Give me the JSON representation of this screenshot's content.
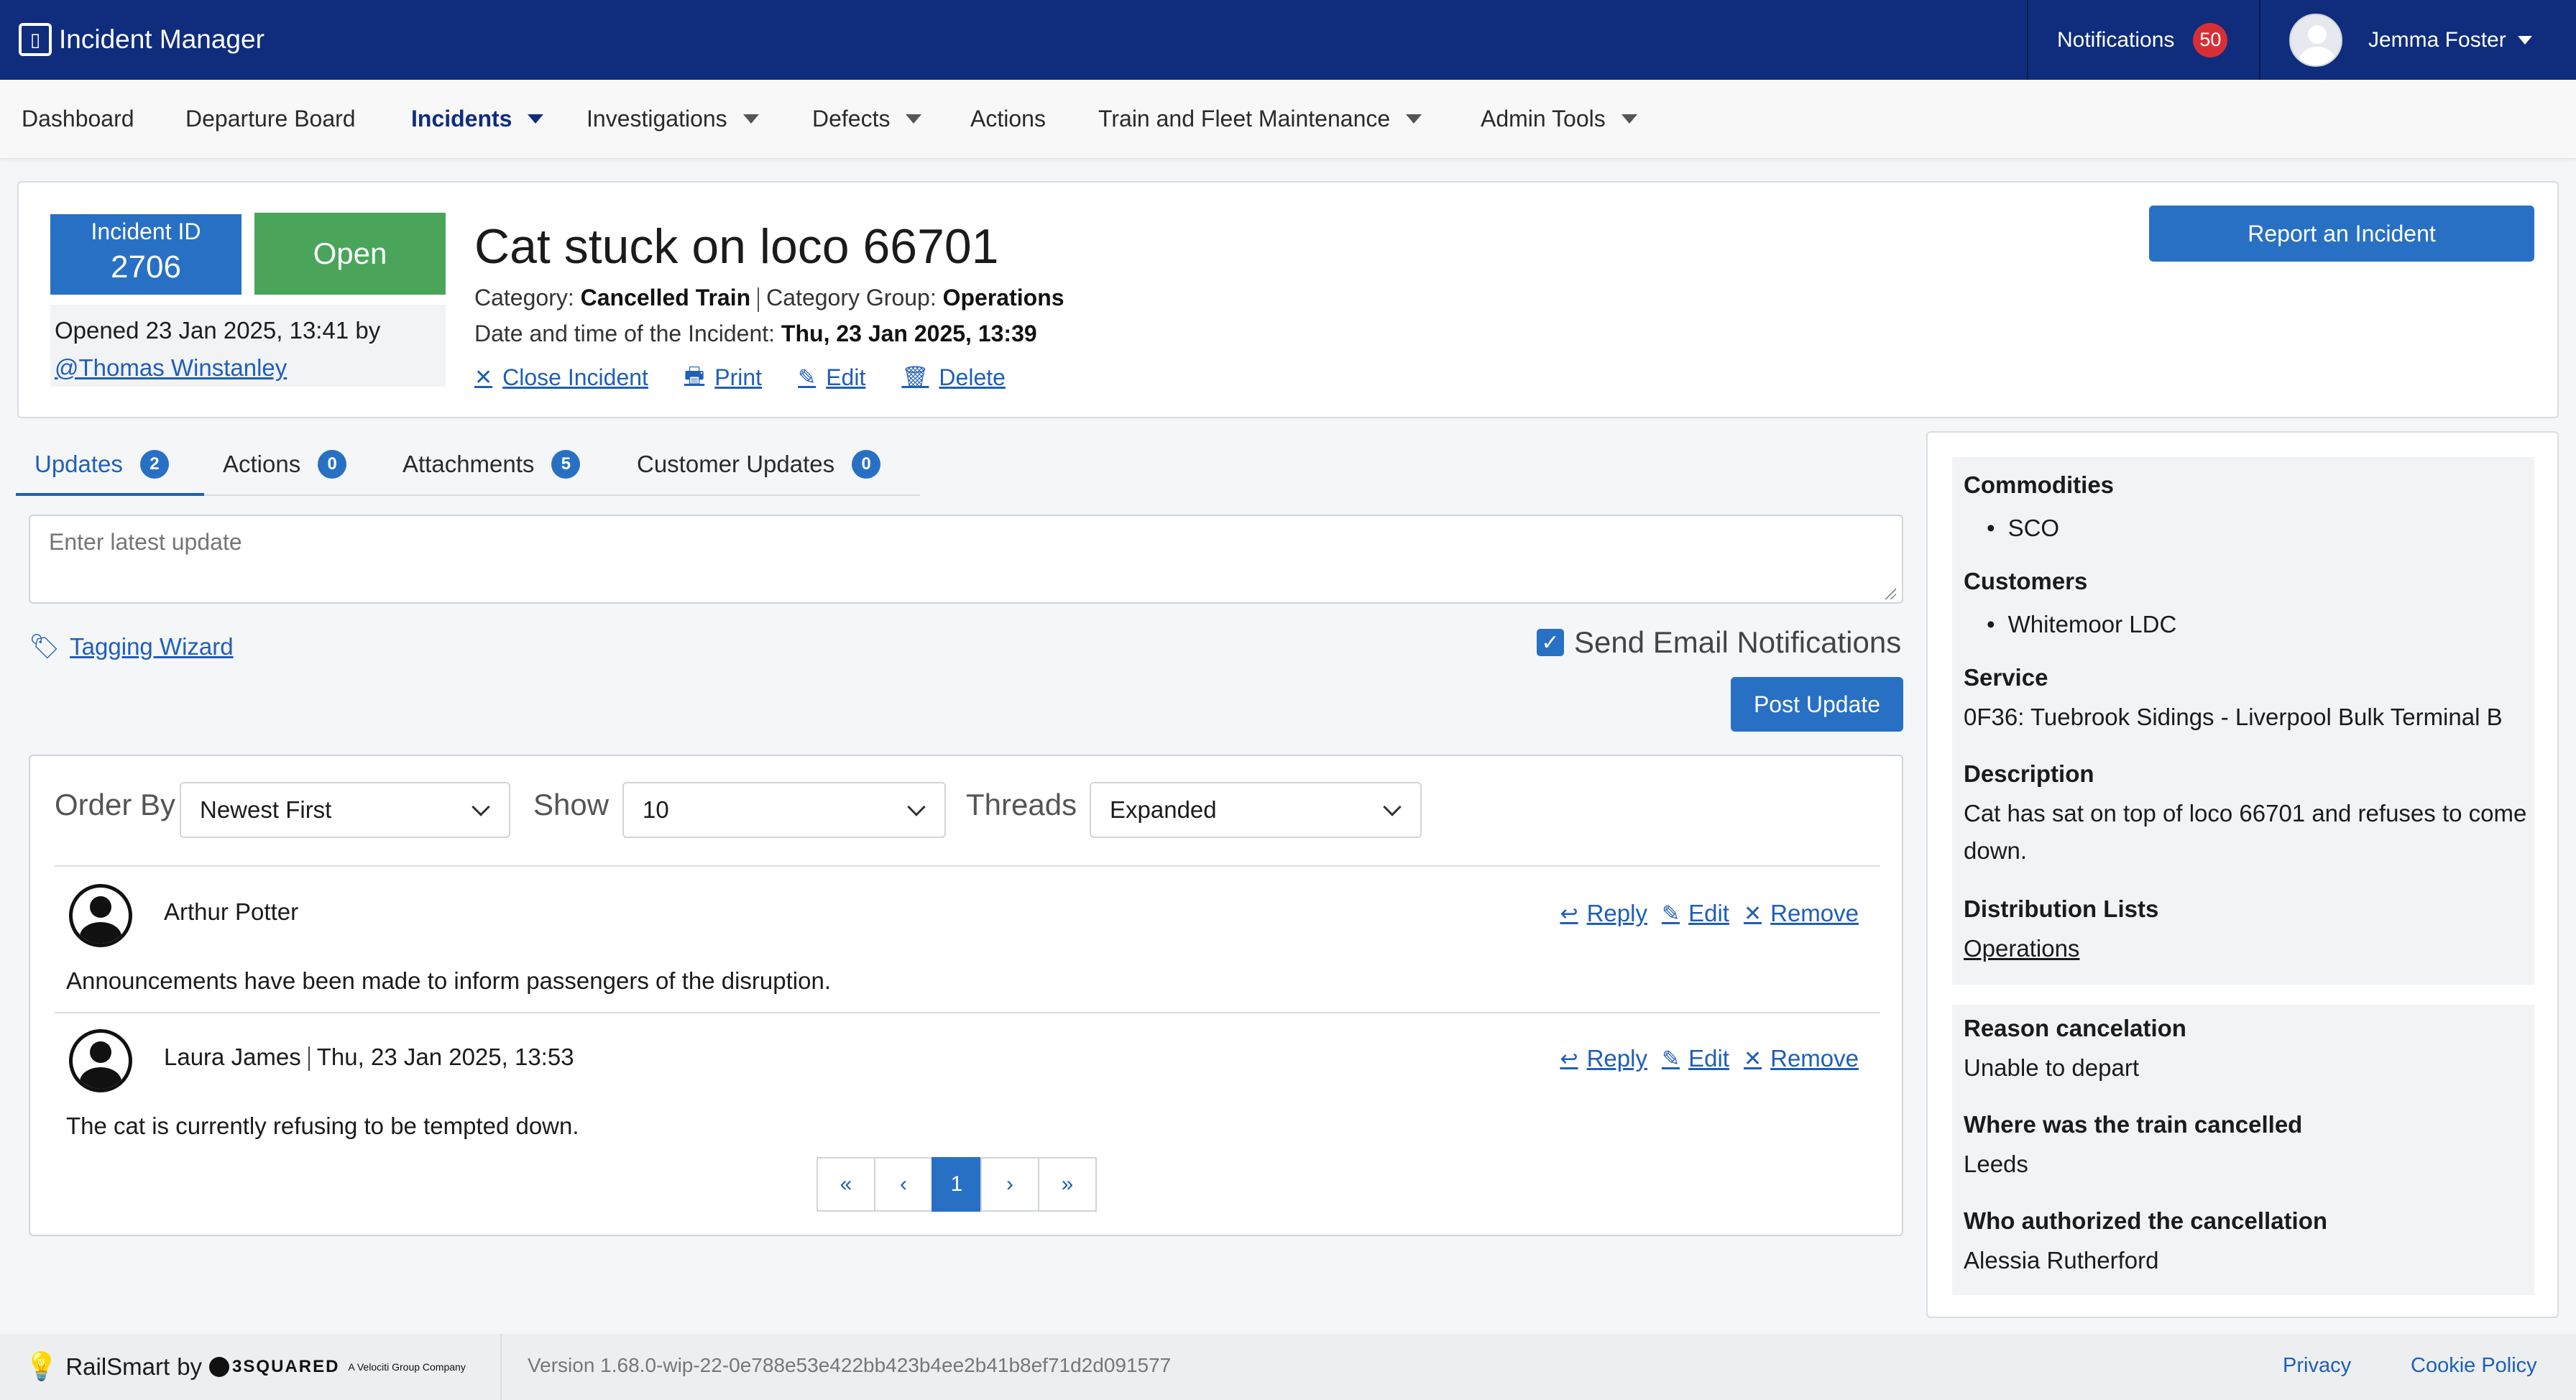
{
  "app": {
    "title": "Incident Manager",
    "logo_icon": "clipboard-icon"
  },
  "topbar": {
    "notifications_label": "Notifications",
    "notifications_count": "50",
    "user_name": "Jemma Foster"
  },
  "nav": [
    {
      "label": "Dashboard"
    },
    {
      "label": "Departure Board"
    },
    {
      "label": "Incidents",
      "active": true
    },
    {
      "label": "Investigations"
    },
    {
      "label": "Defects"
    },
    {
      "label": "Actions"
    },
    {
      "label": "Train and Fleet Maintenance"
    },
    {
      "label": "Admin Tools"
    }
  ],
  "incident": {
    "id_label": "Incident ID",
    "id": "2706",
    "status": "Open",
    "opened_text": "Opened 23 Jan 2025, 13:41 by",
    "opened_by": "@Thomas Winstanley",
    "title": "Cat stuck on loco 66701",
    "category_label": "Category:",
    "category": "Cancelled Train",
    "category_group_label": "Category Group:",
    "category_group": "Operations",
    "datetime_label": "Date and time of the Incident:",
    "datetime": "Thu, 23 Jan 2025, 13:39",
    "close_label": "Close Incident",
    "print_label": "Print",
    "edit_label": "Edit",
    "delete_label": "Delete",
    "report_btn": "Report an Incident"
  },
  "tabs": [
    {
      "label": "Updates",
      "count": "2"
    },
    {
      "label": "Actions",
      "count": "0"
    },
    {
      "label": "Attachments",
      "count": "5"
    },
    {
      "label": "Customer Updates",
      "count": "0"
    }
  ],
  "update_form": {
    "placeholder": "Enter latest update",
    "tagging_wizard": "Tagging Wizard",
    "send_email_label": "Send Email Notifications",
    "send_email_checked": true,
    "post_btn": "Post Update"
  },
  "filters": {
    "order_label": "Order By",
    "order_value": "Newest First",
    "show_label": "Show",
    "show_value": "10",
    "threads_label": "Threads",
    "threads_value": "Expanded"
  },
  "updates": [
    {
      "author": "Arthur Potter",
      "timestamp": "",
      "text": "Announcements have been made to inform passengers of the disruption."
    },
    {
      "author": "Laura James",
      "timestamp": "Thu, 23 Jan 2025, 13:53",
      "text": "The cat is currently refusing to be tempted down."
    }
  ],
  "update_actions": {
    "reply": "Reply",
    "edit": "Edit",
    "remove": "Remove"
  },
  "pagination": {
    "first": "«",
    "prev": "‹",
    "current": "1",
    "next": "›",
    "last": "»"
  },
  "side": {
    "commodities_label": "Commodities",
    "commodities": [
      "SCO"
    ],
    "customers_label": "Customers",
    "customers": [
      "Whitemoor LDC"
    ],
    "service_label": "Service",
    "service": "0F36: Tuebrook Sidings - Liverpool Bulk Terminal B",
    "description_label": "Description",
    "description": "Cat has sat on top of loco 66701 and refuses to come down.",
    "distribution_label": "Distribution Lists",
    "distribution": "Operations",
    "reason_label": "Reason cancelation",
    "reason": "Unable to depart",
    "where_label": "Where was the train cancelled",
    "where": "Leeds",
    "who_label": "Who authorized the cancellation",
    "who": "Alessia Rutherford"
  },
  "footer": {
    "brand": "RailSmart",
    "by": "by",
    "partner": "3SQUARED",
    "partner_tag": "A Velociti Group Company",
    "version": "Version 1.68.0-wip-22-0e788e53e422bb423b4ee2b41b8ef71d2d091577",
    "privacy": "Privacy",
    "cookie": "Cookie Policy"
  },
  "colors": {
    "primary": "#2870c4",
    "topbar": "#0f2d7c",
    "open": "#4aa55a",
    "badge_red": "#d82f36"
  }
}
